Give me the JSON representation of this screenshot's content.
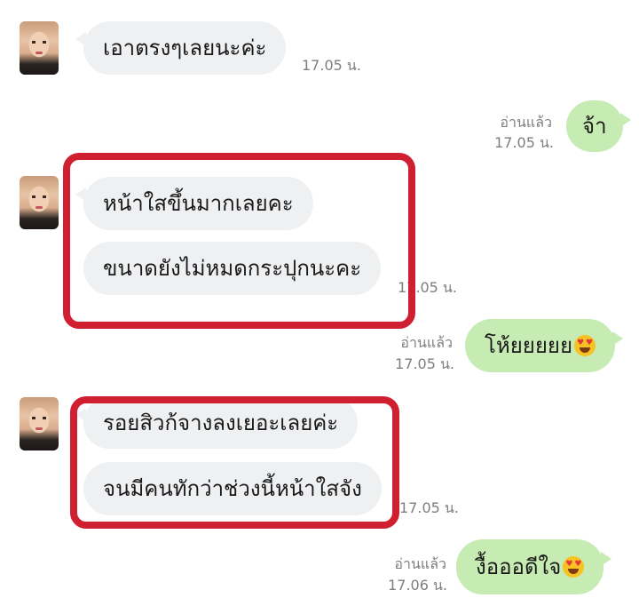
{
  "messages": {
    "m1": {
      "text": "เอาตรงๆเลยนะค่ะ",
      "time": "17.05 น."
    },
    "m2": {
      "text": "จ้า",
      "read": "อ่านแล้ว",
      "time": "17.05 น."
    },
    "m3": {
      "text": "หน้าใสขึ้นมากเลยคะ"
    },
    "m4": {
      "text": "ขนาดยังไม่หมดกระปุกนะคะ",
      "time": "17.05 น."
    },
    "m5": {
      "text": "โห้ยยยยย",
      "emoji": "heart-eyes-emoji",
      "read": "อ่านแล้ว",
      "time": "17.05 น."
    },
    "m6": {
      "text": "รอยสิวก้จางลงเยอะเลยค่ะ"
    },
    "m7": {
      "text": "จนมีคนทักว่าช่วงนี้หน้าใสจัง",
      "time": "17.05 น."
    },
    "m8": {
      "text": "งื้อออดีใจ",
      "emoji": "heart-eyes-emoji",
      "read": "อ่านแล้ว",
      "time": "17.06 น."
    }
  },
  "colors": {
    "incoming_bubble": "#eff0f2",
    "outgoing_bubble": "#c6ebb3",
    "highlight_box": "#cf1f31",
    "meta_text": "#7e7e7e"
  }
}
